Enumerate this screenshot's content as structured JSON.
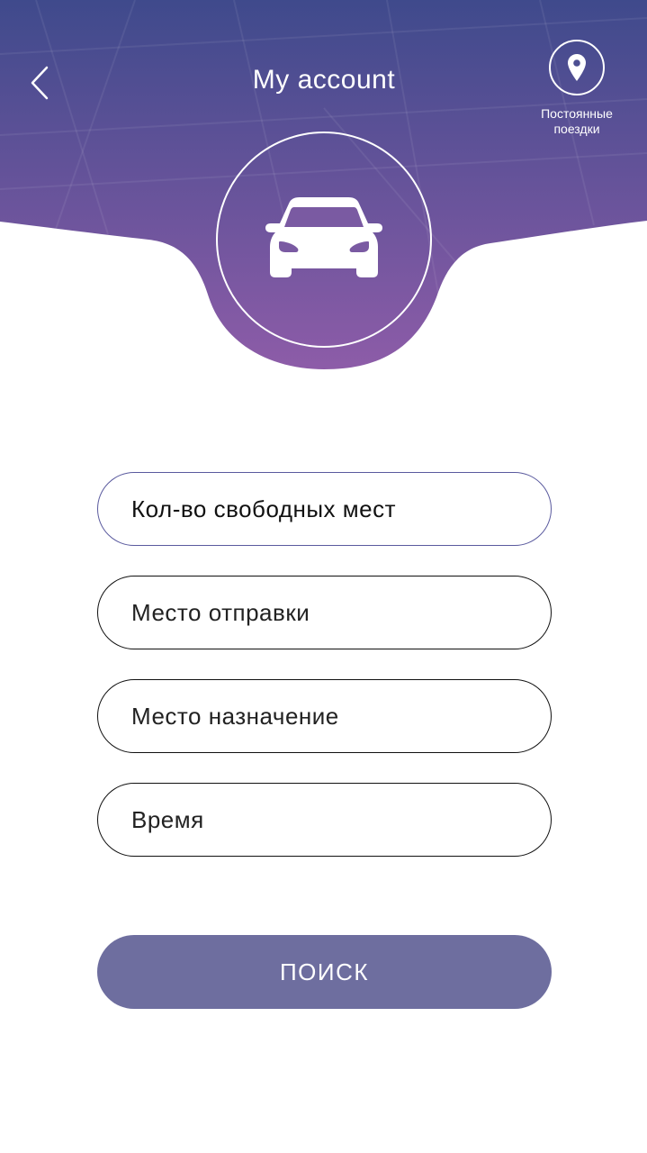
{
  "header": {
    "title": "My account",
    "back_icon": "chevron-left-icon",
    "trips": {
      "icon": "map-pin-icon",
      "label": "Постоянные поездки"
    },
    "avatar_icon": "car-icon"
  },
  "form": {
    "fields": [
      {
        "label": "Кол-во свободных мест"
      },
      {
        "label": "Место отправки"
      },
      {
        "label": "Место назначение"
      },
      {
        "label": "Время"
      }
    ],
    "submit_label": "ПОИСК"
  },
  "colors": {
    "gradient_top": "#3f4a8c",
    "gradient_bottom": "#8a5aa6",
    "button_bg": "#6e6e9f",
    "active_border": "#5a5a9e"
  }
}
